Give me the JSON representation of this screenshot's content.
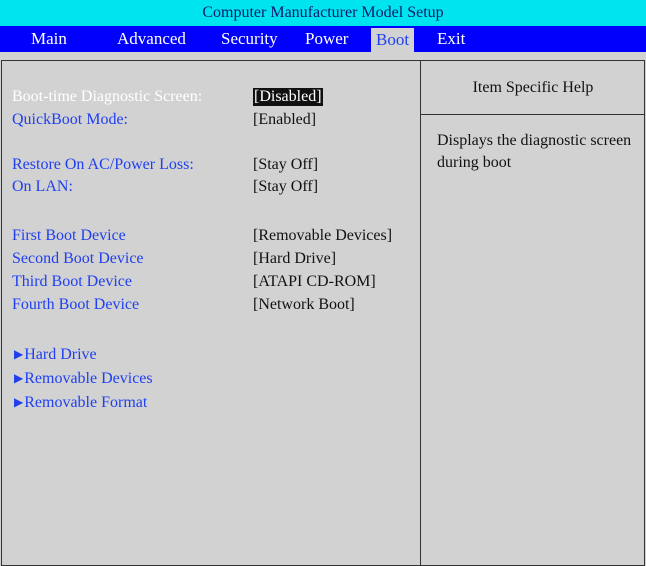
{
  "window": {
    "title": "Computer Manufacturer Model Setup"
  },
  "menu": {
    "items": [
      {
        "label": "Main"
      },
      {
        "label": "Advanced"
      },
      {
        "label": "Security"
      },
      {
        "label": "Power"
      },
      {
        "label": "Boot"
      },
      {
        "label": "Exit"
      }
    ],
    "active": "Boot"
  },
  "settings": [
    {
      "label": "Boot-time Diagnostic Screen:",
      "value": "[Disabled]"
    },
    {
      "label": "QuickBoot Mode:",
      "value": "[Enabled]"
    },
    {
      "label": "Restore On AC/Power Loss:",
      "value": "[Stay Off]"
    },
    {
      "label": "On LAN:",
      "value": "[Stay Off]"
    },
    {
      "label": "First Boot Device",
      "value": "[Removable Devices]"
    },
    {
      "label": "Second Boot Device",
      "value": "[Hard Drive]"
    },
    {
      "label": "Third Boot Device",
      "value": "[ATAPI CD-ROM]"
    },
    {
      "label": "Fourth Boot Device",
      "value": "[Network Boot]"
    }
  ],
  "submenus": [
    {
      "label": "Hard Drive"
    },
    {
      "label": "Removable Devices"
    },
    {
      "label": "Removable Format"
    }
  ],
  "help": {
    "title": "Item Specific Help",
    "text": "Displays the diagnostic screen during boot"
  },
  "colors": {
    "title_bar": "#00e4f0",
    "menu_bar": "#0000fc",
    "label_text": "#2040f0",
    "panel_bg": "#d2d2d2"
  },
  "icons": {
    "submenu_arrow": "triangle-right-icon"
  }
}
